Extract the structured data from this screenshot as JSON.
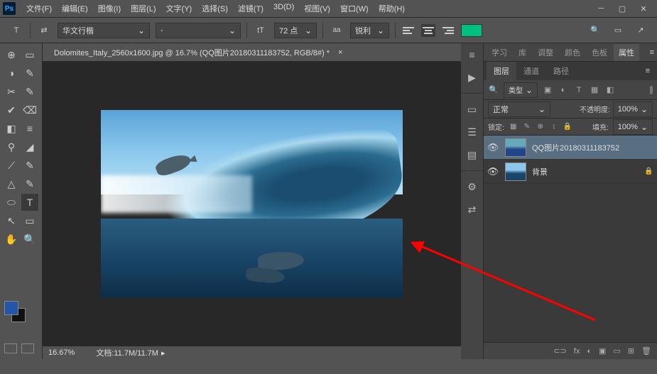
{
  "titlebar": {
    "logo": "Ps",
    "menus": [
      "文件(F)",
      "编辑(E)",
      "图像(I)",
      "图层(L)",
      "文字(Y)",
      "选择(S)",
      "滤镜(T)",
      "3D(D)",
      "视图(V)",
      "窗口(W)",
      "帮助(H)"
    ]
  },
  "options": {
    "tool_glyph": "T",
    "toggle_glyph": "⇄",
    "font": "华文行楷",
    "style": "-",
    "size_glyph": "tT",
    "size": "72 点",
    "aa_glyph": "aa",
    "aa": "锐利",
    "right_icons": [
      "🔍",
      "▭",
      "↗"
    ]
  },
  "document": {
    "tab": "Dolomites_Italy_2560x1600.jpg @ 16.7% (QQ图片20180311183752, RGB/8#) *",
    "zoom": "16.67%",
    "status_label": "文档:",
    "status_value": "11.7M/11.7M"
  },
  "tools": [
    "⊕",
    "▭",
    "◑",
    "✎",
    "✂",
    "✎",
    "✔",
    "⌫",
    "◧",
    "≡",
    "⚲",
    "◢",
    "⟋",
    "✎",
    "△",
    "✎",
    "⬭",
    "T",
    "↖",
    "▭",
    "✋",
    "🔍"
  ],
  "side_icons": [
    "≡",
    "▶",
    "",
    "▭",
    "☰",
    "▤",
    "",
    "⚙",
    "⇄"
  ],
  "panels": {
    "top_tabs": [
      "学习",
      "库",
      "调整",
      "颜色",
      "色板",
      "属性"
    ],
    "top_active": 5,
    "layer_tabs": [
      "图层",
      "通道",
      "路径"
    ],
    "layer_active": 0,
    "filter_label": "类型",
    "filter_search_glyph": "🔍",
    "filter_icons": [
      "▣",
      "◐",
      "T",
      "▦",
      "◧"
    ],
    "blend": "正常",
    "opacity_label": "不透明度:",
    "opacity": "100%",
    "lock_label": "锁定:",
    "lock_icons": [
      "▦",
      "✎",
      "⊕",
      "↕",
      "🔒"
    ],
    "fill_label": "填充:",
    "fill": "100%",
    "layers": [
      {
        "name": "QQ图片20180311183752",
        "visible": true,
        "selected": true,
        "locked": false,
        "smart": true
      },
      {
        "name": "背景",
        "visible": true,
        "selected": false,
        "locked": true,
        "smart": false
      }
    ],
    "bottom_icons": [
      "⊂⊃",
      "fx",
      "◐",
      "▣",
      "▭",
      "⊞",
      "🗑"
    ]
  }
}
